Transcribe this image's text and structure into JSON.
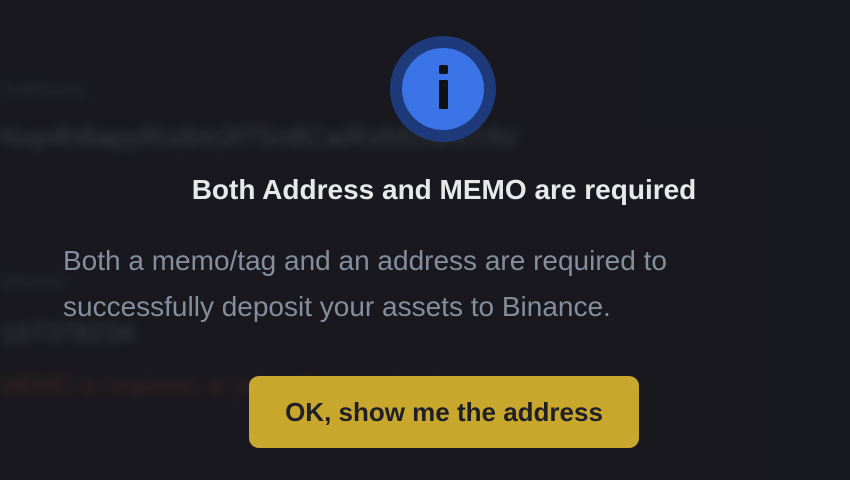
{
  "background": {
    "address_label": "Address",
    "address_value": "Nxp4h8apyRis6m3f75n8CaiRxfrEn8N7AV",
    "memo_label": "Memo",
    "memo_value": "167378234",
    "warning": "MEMO is required, or you will lose your coins"
  },
  "modal": {
    "icon": "info-icon",
    "title": "Both Address and MEMO are required",
    "description": "Both a memo/tag and an address are required to successfully deposit your assets to Binance.",
    "ok_button": "OK, show me the address"
  },
  "colors": {
    "page_background": "#1c1d21",
    "icon_ring": "#1f3a7a",
    "icon_fill": "#3a74e6",
    "button_background": "#c9a62c",
    "title_text": "#e6e8ea",
    "body_text": "#848e9c"
  }
}
